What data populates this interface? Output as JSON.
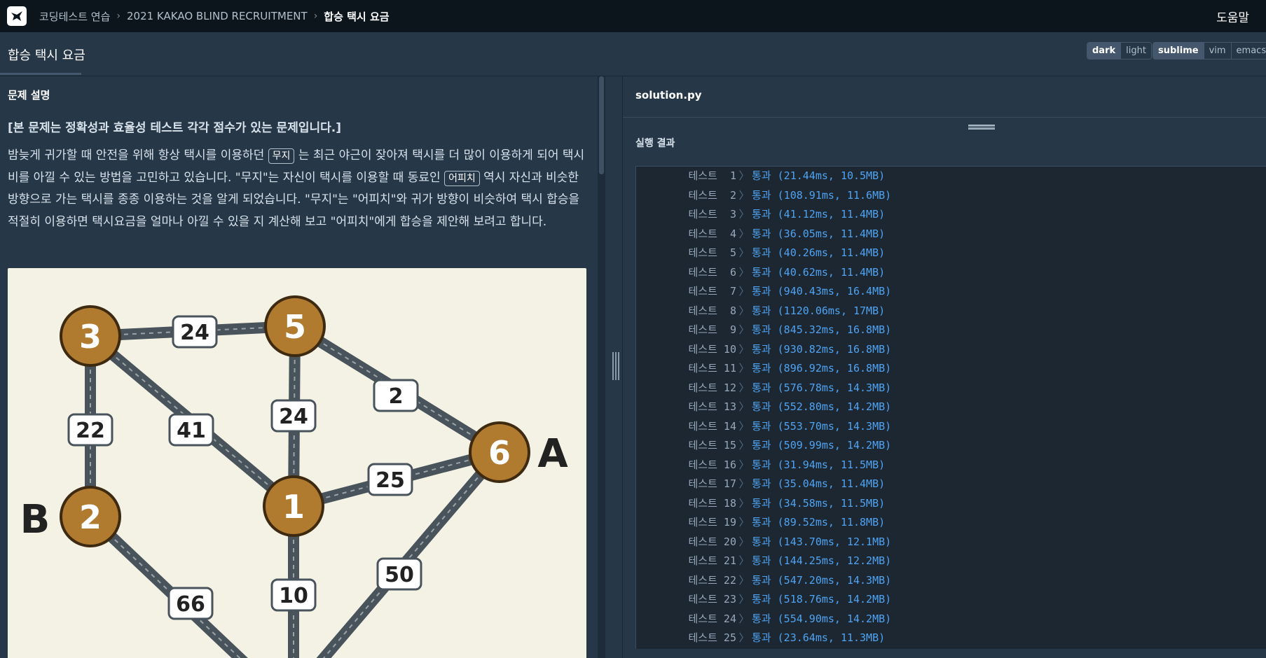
{
  "nav": {
    "breadcrumbs": [
      "코딩테스트 연습",
      "2021 KAKAO BLIND RECRUITMENT",
      "합승 택시 요금"
    ],
    "help": "도움말"
  },
  "title": "합승 택시 요금",
  "theme_options": [
    "dark",
    "light"
  ],
  "theme_selected": "dark",
  "keymap_options": [
    "sublime",
    "vim",
    "emacs"
  ],
  "keymap_selected": "sublime",
  "description": {
    "section": "문제 설명",
    "notice": "[본 문제는 정확성과 효율성 테스트 각각 점수가 있는 문제입니다.]",
    "para_1": "밤늦게 귀가할 때 안전을 위해 항상 택시를 이용하던 ",
    "code_1": "무지",
    "para_2": " 는 최근 야근이 잦아져 택시를 더 많이 이용하게 되어 택시비를 아낄 수 있는 방법을 고민하고 있습니다. \"무지\"는 자신이 택시를 이용할 때 동료인 ",
    "code_2": "어피치",
    "para_3": " 역시 자신과 비슷한 방향으로 가는 택시를 종종 이용하는 것을 알게 되었습니다. \"무지\"는 \"어피치\"와 귀가 방향이 비슷하여 택시 합승을 적절히 이용하면 택시요금을 얼마나 아낄 수 있을 지 계산해 보고 \"어피치\"에게 합승을 제안해 보려고 합니다."
  },
  "graph": {
    "nodes": [
      {
        "id": "3"
      },
      {
        "id": "5"
      },
      {
        "id": "6",
        "label": "A"
      },
      {
        "id": "2",
        "label": "B"
      },
      {
        "id": "1"
      }
    ],
    "edges": [
      {
        "from": "3",
        "to": "5",
        "fare": "24"
      },
      {
        "from": "3",
        "to": "2",
        "fare": "22"
      },
      {
        "from": "3",
        "to": "1",
        "fare": "41"
      },
      {
        "from": "5",
        "to": "1",
        "fare": "24"
      },
      {
        "from": "5",
        "to": "6",
        "fare": "2"
      },
      {
        "from": "1",
        "to": "6",
        "fare": "25"
      },
      {
        "from": "6",
        "to": "",
        "fare": "50"
      },
      {
        "from": "1",
        "to": "",
        "fare": "10"
      },
      {
        "from": "2",
        "to": "",
        "fare": "66"
      }
    ]
  },
  "editor": {
    "filename": "solution.py",
    "result_label": "실행 결과"
  },
  "results": [
    {
      "name": "테스트  1",
      "status": "통과 (21.44ms, 10.5MB)"
    },
    {
      "name": "테스트  2",
      "status": "통과 (108.91ms, 11.6MB)"
    },
    {
      "name": "테스트  3",
      "status": "통과 (41.12ms, 11.4MB)"
    },
    {
      "name": "테스트  4",
      "status": "통과 (36.05ms, 11.4MB)"
    },
    {
      "name": "테스트  5",
      "status": "통과 (40.26ms, 11.4MB)"
    },
    {
      "name": "테스트  6",
      "status": "통과 (40.62ms, 11.4MB)"
    },
    {
      "name": "테스트  7",
      "status": "통과 (940.43ms, 16.4MB)"
    },
    {
      "name": "테스트  8",
      "status": "통과 (1120.06ms, 17MB)"
    },
    {
      "name": "테스트  9",
      "status": "통과 (845.32ms, 16.8MB)"
    },
    {
      "name": "테스트 10",
      "status": "통과 (930.82ms, 16.8MB)"
    },
    {
      "name": "테스트 11",
      "status": "통과 (896.92ms, 16.8MB)"
    },
    {
      "name": "테스트 12",
      "status": "통과 (576.78ms, 14.3MB)"
    },
    {
      "name": "테스트 13",
      "status": "통과 (552.80ms, 14.2MB)"
    },
    {
      "name": "테스트 14",
      "status": "통과 (553.70ms, 14.3MB)"
    },
    {
      "name": "테스트 15",
      "status": "통과 (509.99ms, 14.2MB)"
    },
    {
      "name": "테스트 16",
      "status": "통과 (31.94ms, 11.5MB)"
    },
    {
      "name": "테스트 17",
      "status": "통과 (35.04ms, 11.4MB)"
    },
    {
      "name": "테스트 18",
      "status": "통과 (34.58ms, 11.5MB)"
    },
    {
      "name": "테스트 19",
      "status": "통과 (89.52ms, 11.8MB)"
    },
    {
      "name": "테스트 20",
      "status": "통과 (143.70ms, 12.1MB)"
    },
    {
      "name": "테스트 21",
      "status": "통과 (144.25ms, 12.2MB)"
    },
    {
      "name": "테스트 22",
      "status": "통과 (547.20ms, 14.3MB)"
    },
    {
      "name": "테스트 23",
      "status": "통과 (518.76ms, 14.2MB)"
    },
    {
      "name": "테스트 24",
      "status": "통과 (554.90ms, 14.2MB)"
    },
    {
      "name": "테스트 25",
      "status": "통과 (23.64ms, 11.3MB)"
    }
  ],
  "colors": {
    "background": "#263747",
    "nav": "#0c151c",
    "pass": "#4fa3f2",
    "node": "#b07a2f",
    "figure_bg": "#f4f2e4"
  }
}
